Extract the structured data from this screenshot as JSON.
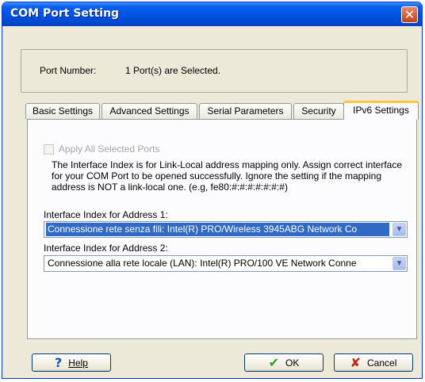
{
  "window": {
    "title": "COM Port Setting",
    "close_icon": "close-icon"
  },
  "port": {
    "label": "Port Number:",
    "value": "1 Port(s) are Selected."
  },
  "tabs": [
    {
      "label": "Basic Settings"
    },
    {
      "label": "Advanced Settings"
    },
    {
      "label": "Serial Parameters"
    },
    {
      "label": "Security"
    },
    {
      "label": "IPv6 Settings",
      "active": true
    }
  ],
  "ipv6": {
    "apply_all_label": "Apply All Selected Ports",
    "description": "The Interface Index is for Link-Local address mapping only. Assign correct interface for your COM Port to be opened successfully. Ignore the setting if the mapping address is NOT a link-local one. (e.g, fe80:#:#:#:#:#:#:#)",
    "address1_label": "Interface Index for Address 1:",
    "address1_value": "Connessione rete senza fili: Intel(R) PRO/Wireless 3945ABG Network Co",
    "address2_label": "Interface Index for Address 2:",
    "address2_value": "Connessione alla rete locale (LAN): Intel(R) PRO/100 VE Network Conne"
  },
  "buttons": {
    "help_icon": "?",
    "help_label": "Help",
    "ok_icon": "✔",
    "ok_label": "OK",
    "cancel_icon": "✘",
    "cancel_label": "Cancel"
  },
  "colors": {
    "titlebar": "#0054e3",
    "selection": "#316ac5",
    "active_tab_highlight": "#ffc83c"
  }
}
